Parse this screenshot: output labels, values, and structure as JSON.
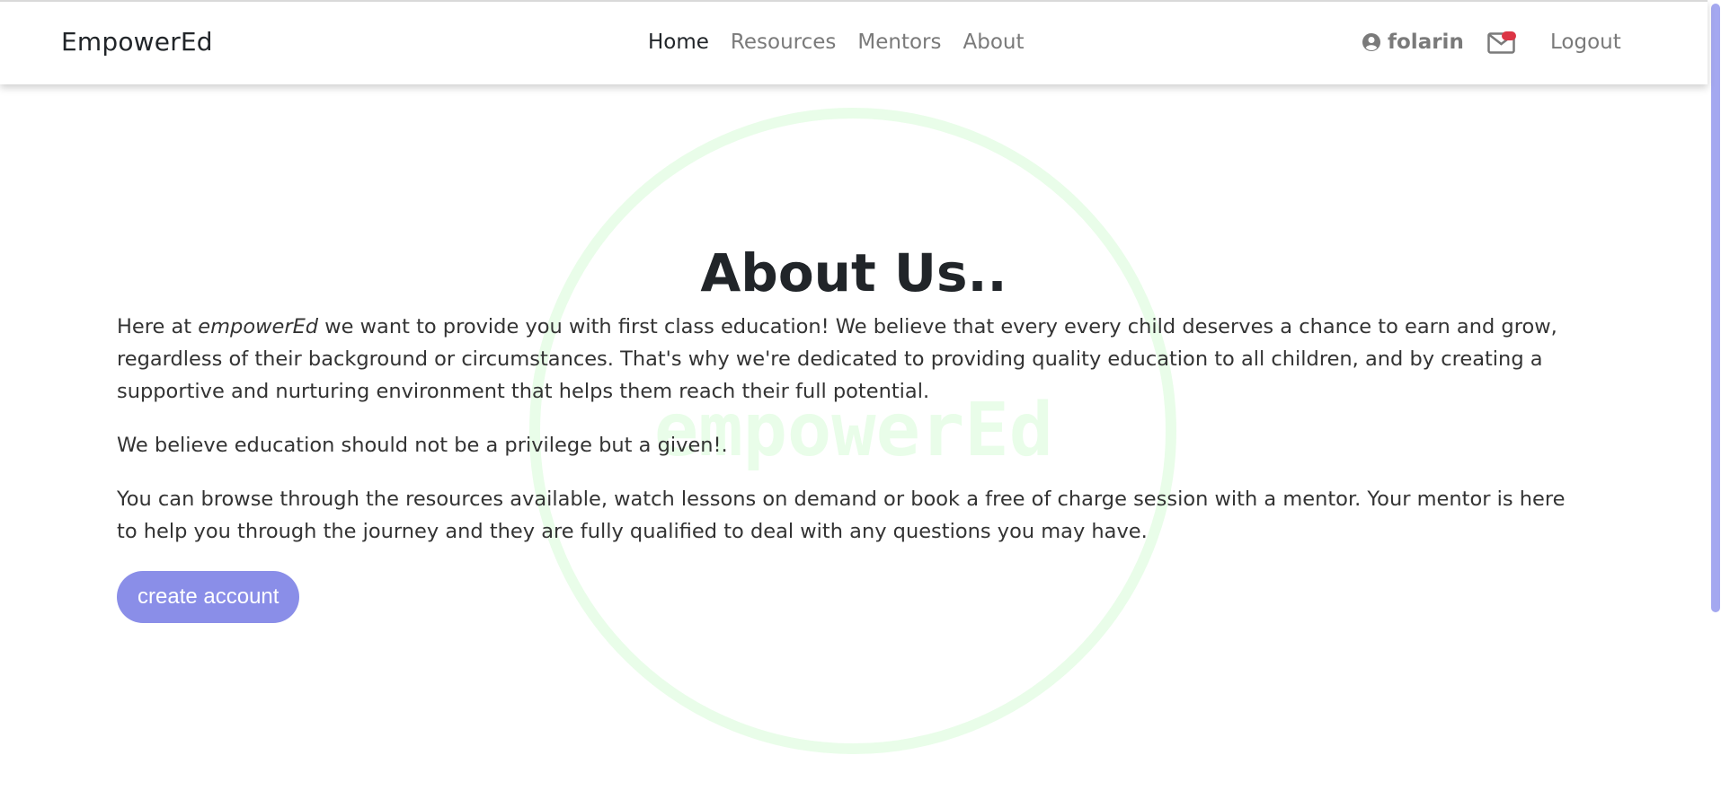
{
  "navbar": {
    "brand": "EmpowerEd",
    "links": [
      "Home",
      "Resources",
      "Mentors",
      "About"
    ],
    "active": "Home",
    "user": {
      "icon": "user-circle-icon",
      "name": "folarin"
    },
    "mail": {
      "icon": "envelope-icon",
      "badge_color": "#dc3545"
    },
    "logout": "Logout"
  },
  "watermark": {
    "text": "empowerEd",
    "color": "#e9fde9"
  },
  "main": {
    "title": "About Us..",
    "intro_prefix": "Here at ",
    "intro_brand": "empowerEd",
    "intro_rest": " we want to provide you with first class education! We believe that every every child deserves a chance to earn and grow, regardless of their background or circumstances. That's why we're dedicated to providing quality education to all children, and by creating a supportive and nurturing environment that helps them reach their full potential.",
    "paragraph2": "We believe education should not be a privilege but a given!.",
    "paragraph3": "You can browse through the resources available, watch lessons on demand or book a free of charge session with a mentor. Your mentor is here to help you through the journey and they are fully qualified to deal with any questions you may have.",
    "cta_label": "create account"
  },
  "colors": {
    "accent": "#8a8ee8",
    "scroll_thumb": "#a4a8f0",
    "text": "#212529",
    "nav_muted": "#7a7a7a"
  }
}
